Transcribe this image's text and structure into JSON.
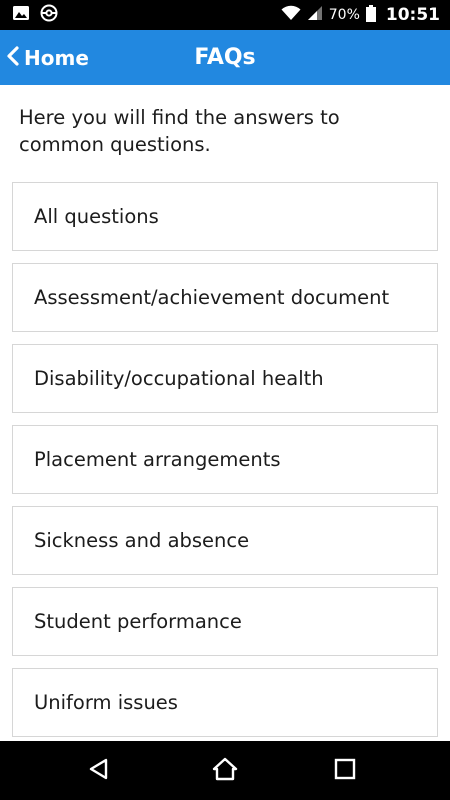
{
  "status_bar": {
    "battery": "70%",
    "time": "10:51",
    "icons": [
      "image-icon",
      "pokeball-icon",
      "wifi-icon",
      "signal-icon",
      "battery-icon"
    ]
  },
  "header": {
    "back_label": "Home",
    "title": "FAQs",
    "color": "#2288e0"
  },
  "intro": "Here you will find the answers to common questions.",
  "faq_items": [
    {
      "label": "All questions"
    },
    {
      "label": "Assessment/achievement document"
    },
    {
      "label": "Disability/occupational health"
    },
    {
      "label": "Placement arrangements"
    },
    {
      "label": "Sickness and absence"
    },
    {
      "label": "Student performance"
    },
    {
      "label": "Uniform issues"
    }
  ],
  "nav_bar": {
    "icons": [
      "back-triangle-icon",
      "home-icon",
      "recents-square-icon"
    ]
  }
}
